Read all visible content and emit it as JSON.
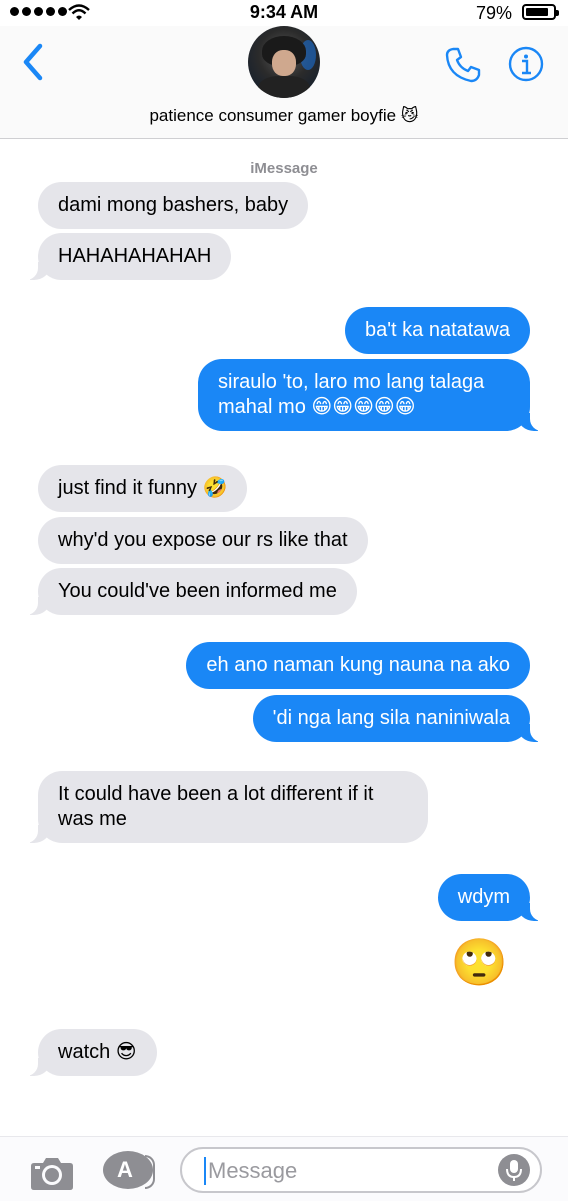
{
  "status_bar": {
    "time": "9:34 AM",
    "battery_percent": "79%",
    "battery_level": 0.79
  },
  "header": {
    "contact_name": "patience consumer gamer boyfie 😼"
  },
  "thread": {
    "service_label": "iMessage",
    "messages": [
      {
        "from": "them",
        "text": "dami mong bashers, baby"
      },
      {
        "from": "them",
        "text": "HAHAHAHAHAH"
      },
      {
        "from": "me",
        "text": "ba't ka natatawa"
      },
      {
        "from": "me",
        "text": "siraulo 'to, laro mo lang talaga mahal mo 😁😁😁😁😁"
      },
      {
        "from": "them",
        "text": "just find it funny 🤣"
      },
      {
        "from": "them",
        "text": "why'd you expose our rs like that"
      },
      {
        "from": "them",
        "text": "You could've been informed me"
      },
      {
        "from": "me",
        "text": "eh ano naman kung nauna na ako"
      },
      {
        "from": "me",
        "text": "'di nga lang sila naniniwala"
      },
      {
        "from": "them",
        "text": "It could have been a lot different if it was me"
      },
      {
        "from": "me",
        "text": "wdym"
      },
      {
        "from": "me",
        "text": "🙄"
      },
      {
        "from": "them",
        "text": "watch 😎"
      }
    ]
  },
  "input_bar": {
    "placeholder": "Message",
    "app_store_glyph": "A"
  },
  "colors": {
    "outgoing_bubble": "#1a87f6",
    "incoming_bubble": "#e5e5ea",
    "accent": "#1a87f6"
  },
  "icons": [
    "signal-dots-icon",
    "wifi-icon",
    "battery-icon",
    "back-chevron-icon",
    "phone-icon",
    "info-icon",
    "camera-icon",
    "app-store-icon",
    "microphone-icon"
  ]
}
